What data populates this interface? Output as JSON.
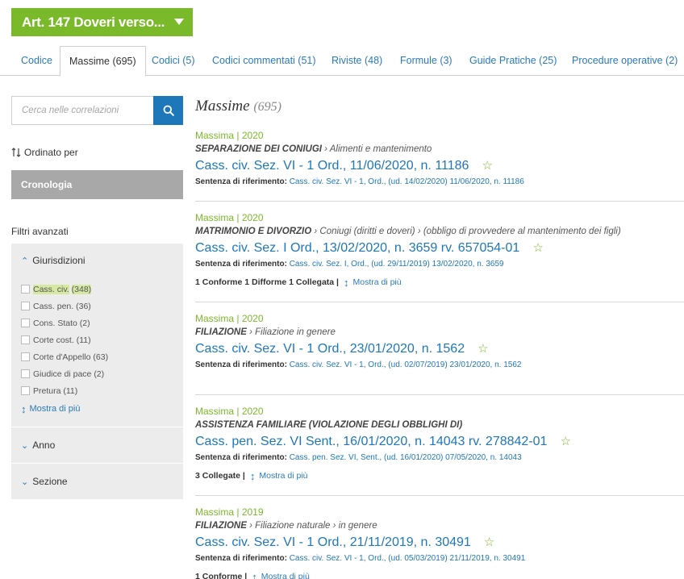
{
  "header": {
    "title": "Art. 147 Doveri verso..."
  },
  "tabs": [
    {
      "label": "Codice"
    },
    {
      "label": "Massime (695)"
    },
    {
      "label": "Codici (5)"
    },
    {
      "label": "Codici commentati (51)"
    },
    {
      "label": "Riviste (48)"
    },
    {
      "label": "Formule (3)"
    },
    {
      "label": "Guide Pratiche (25)"
    },
    {
      "label": "Procedure operative (2)"
    }
  ],
  "search": {
    "placeholder": "Cerca nelle correlazioni"
  },
  "sort": {
    "label": "Ordinato per",
    "value": "Cronologia"
  },
  "filters": {
    "title": "Filtri avanzati",
    "jurisdictions": {
      "label": "Giurisdizioni",
      "items": [
        {
          "name": "Cass. civ.",
          "count": "(348)"
        },
        {
          "name": "Cass. pen.",
          "count": "(36)"
        },
        {
          "name": "Cons. Stato",
          "count": "(2)"
        },
        {
          "name": "Corte cost.",
          "count": "(11)"
        },
        {
          "name": "Corte d'Appello",
          "count": "(63)"
        },
        {
          "name": "Giudice di pace",
          "count": "(2)"
        },
        {
          "name": "Pretura",
          "count": "(11)"
        }
      ],
      "more": "Mostra di più"
    },
    "year": {
      "label": "Anno"
    },
    "section": {
      "label": "Sezione"
    }
  },
  "main": {
    "title": "Massime",
    "count": "(695)"
  },
  "results": [
    {
      "type": "Massima",
      "year": "2020",
      "category_bold": "SEPARAZIONE DEI CONIUGI",
      "category_rest": " › Alimenti e mantenimento",
      "title": "Cass. civ. Sez. VI - 1 Ord., 11/06/2020, n. 11186",
      "ref_label": "Sentenza di riferimento:",
      "ref": "Cass. civ. Sez. VI - 1, Ord., (ud. 14/02/2020) 11/06/2020, n. 11186",
      "extra": "",
      "more": ""
    },
    {
      "type": "Massima",
      "year": "2020",
      "category_bold": "MATRIMONIO E DIVORZIO",
      "category_rest": " › Coniugi (diritti e doveri) › (obbligo di provvedere al mantenimento dei figli)",
      "title": "Cass. civ. Sez. I Ord., 13/02/2020, n. 3659 rv. 657054-01",
      "ref_label": "Sentenza di riferimento:",
      "ref": "Cass. civ. Sez. I, Ord., (ud. 29/11/2019) 13/02/2020, n. 3659",
      "extra": "1 Conforme 1 Difforme 1 Collegata |",
      "more": "Mostra di più"
    },
    {
      "type": "Massima",
      "year": "2020",
      "category_bold": "FILIAZIONE",
      "category_rest": " › Filiazione in genere",
      "title": "Cass. civ. Sez. VI - 1 Ord., 23/01/2020, n. 1562",
      "ref_label": "Sentenza di riferimento:",
      "ref": "Cass. civ. Sez. VI - 1, Ord., (ud. 02/07/2019) 23/01/2020, n. 1562",
      "extra": "",
      "more": ""
    },
    {
      "type": "Massima",
      "year": "2020",
      "category_bold": "ASSISTENZA FAMILIARE (VIOLAZIONE DEGLI OBBLIGHI DI)",
      "category_rest": "",
      "title": "Cass. pen. Sez. VI Sent., 16/01/2020, n. 14043 rv. 278842-01",
      "ref_label": "Sentenza di riferimento:",
      "ref": "Cass. pen. Sez. VI, Sent., (ud. 16/01/2020) 07/05/2020, n. 14043",
      "extra": "3 Collegate |",
      "more": "Mostra di più"
    },
    {
      "type": "Massima",
      "year": "2019",
      "category_bold": "FILIAZIONE",
      "category_rest": " › Filiazione naturale › in genere",
      "title": "Cass. civ. Sez. VI - 1 Ord., 21/11/2019, n. 30491",
      "ref_label": "Sentenza di riferimento:",
      "ref": "Cass. civ. Sez. VI - 1, Ord., (ud. 05/03/2019) 21/11/2019, n. 30491",
      "extra": "1 Conforme |",
      "more": "Mostra di più"
    }
  ],
  "colors": {
    "green": "#7ab929",
    "blue": "#1e77b8",
    "gray_button": "#a8a8a8"
  }
}
